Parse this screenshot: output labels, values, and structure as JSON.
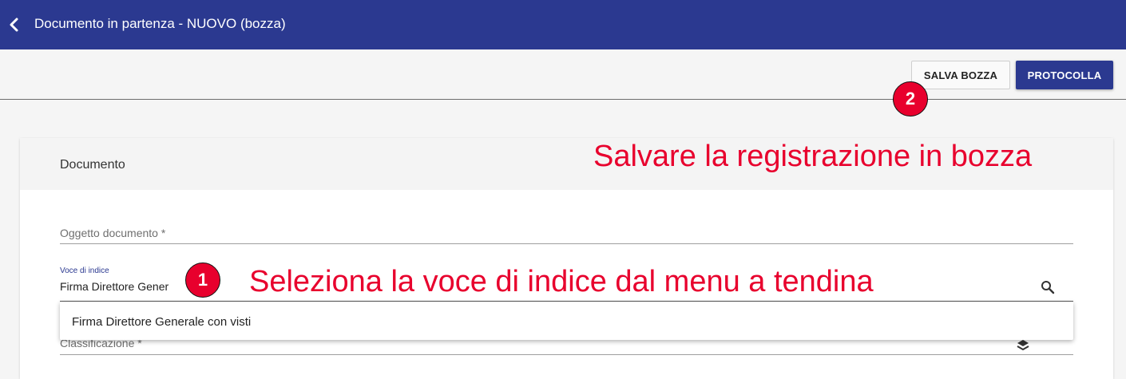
{
  "header": {
    "title": "Documento in partenza - NUOVO (bozza)"
  },
  "toolbar": {
    "save_draft_label": "SALVA BOZZA",
    "protocol_label": "PROTOCOLLA"
  },
  "card": {
    "title": "Documento",
    "fields": {
      "oggetto_label": "Oggetto documento *",
      "voce_label": "Voce di indice",
      "voce_value": "Firma Direttore Gener",
      "classificazione_label": "Classificazione *"
    },
    "dropdown": {
      "options": [
        "Firma Direttore Generale con visti"
      ]
    }
  },
  "annotations": {
    "step1_number": "1",
    "step1_text": "Seleziona la voce di indice dal menu a tendina",
    "step2_number": "2",
    "step2_text": "Salvare la registrazione in bozza"
  },
  "colors": {
    "primary": "#2b3990",
    "annotation": "#e8002d"
  },
  "icons": {
    "back": "chevron-left-icon",
    "search": "search-icon",
    "classification": "layers-icon"
  }
}
